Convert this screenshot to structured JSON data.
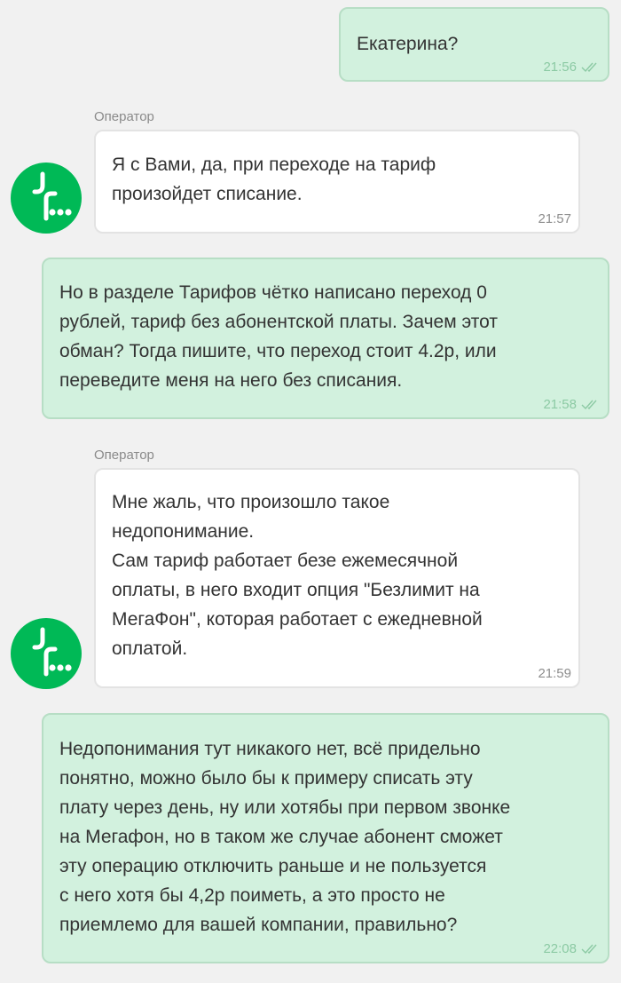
{
  "colors": {
    "background": "#f1f1f1",
    "outgoing_bubble": "#d2f1de",
    "outgoing_border": "#b7dec5",
    "incoming_bubble": "#ffffff",
    "brand_green": "#00b956",
    "text": "#333333",
    "timestamp_outgoing": "#8ccaa4",
    "timestamp_incoming": "#8d8d8d"
  },
  "messages": [
    {
      "direction": "outgoing",
      "text": "Екатерина?",
      "time": "21:56",
      "status_icon": "double-check-icon"
    },
    {
      "direction": "incoming",
      "sender": "Оператор",
      "avatar_icon": "megafon-logo-icon",
      "text": "Я с Вами, да, при переходе на тариф\nпроизойдет списание.",
      "time": "21:57"
    },
    {
      "direction": "outgoing",
      "text": "Но в разделе Тарифов чётко написано переход 0\nрублей, тариф без абонентской платы. Зачем этот\nобман? Тогда пишите, что переход стоит 4.2р, или\nпереведите меня на него без списания.",
      "time": "21:58",
      "status_icon": "double-check-icon"
    },
    {
      "direction": "incoming",
      "sender": "Оператор",
      "avatar_icon": "megafon-logo-icon",
      "text": "Мне жаль, что произошло такое\nнедопонимание.\nСам тариф работает безе ежемесячной\nоплаты, в него входит опция \"Безлимит на\nМегаФон\", которая работает с ежедневной\nоплатой.",
      "time": "21:59"
    },
    {
      "direction": "outgoing",
      "text": "Недопонимания тут никакого нет, всё придельно\nпонятно, можно было бы к примеру списать эту\nплату через день, ну или хотябы при первом звонке\nна Мегафон, но в таком же случае абонент сможет\nэту операцию отключить раньше и не пользуется\nс него хотя бы 4,2р поиметь, а это просто не\nприемлемо для вашей компании, правильно?",
      "time": "22:08",
      "status_icon": "double-check-icon"
    }
  ]
}
